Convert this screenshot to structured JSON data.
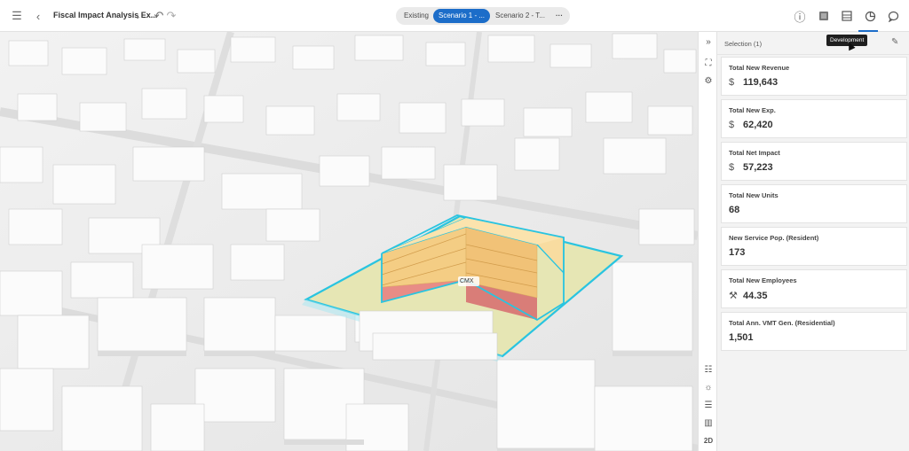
{
  "header": {
    "menu_icon": "hamburger-menu-icon",
    "back_icon": "chevron-left-icon",
    "title": "Fiscal Impact Analysis Ex...",
    "title_dropdown_icon": "chevron-down-icon",
    "undo_icon": "undo-icon",
    "redo_icon": "redo-icon",
    "scenario_tabs": [
      {
        "label": "Existing",
        "active": false
      },
      {
        "label": "Scenario 1 - ...",
        "active": true
      },
      {
        "label": "Scenario 2 - T...",
        "active": false
      }
    ],
    "more_icon": "more-horizontal-icon",
    "right_icons": [
      "info-icon",
      "dashboard-icon",
      "table-icon",
      "chart-pie-icon",
      "comment-icon"
    ],
    "tooltip": "Development"
  },
  "map": {
    "label": "CMX",
    "tools": [
      "collapse-panel-icon",
      "layer-icon",
      "measure-icon",
      "basemap-icon",
      "daylight-icon",
      "legend-icon",
      "chart-icon"
    ],
    "mode_label": "2D"
  },
  "panel": {
    "selection_label": "Selection (1)",
    "edit_icon": "pencil-icon",
    "cards": [
      {
        "label": "Total New Revenue",
        "prefix": "$",
        "value": "119,643"
      },
      {
        "label": "Total New Exp.",
        "prefix": "$",
        "value": "62,420"
      },
      {
        "label": "Total Net Impact",
        "prefix": "$",
        "value": "57,223"
      },
      {
        "label": "Total New Units",
        "prefix": "",
        "value": "68"
      },
      {
        "label": "New Service Pop. (Resident)",
        "prefix": "",
        "value": "173"
      },
      {
        "label": "Total New Employees",
        "prefix": "⚒",
        "value": "44.35"
      },
      {
        "label": "Total Ann. VMT Gen. (Residential)",
        "prefix": "",
        "value": "1,501"
      }
    ]
  },
  "colors": {
    "accent": "#1c6dc9",
    "selection_outline": "#29c4e0",
    "residential": "#f6d38a",
    "commercial": "#e88c86",
    "parcel": "#e6e6b4"
  }
}
